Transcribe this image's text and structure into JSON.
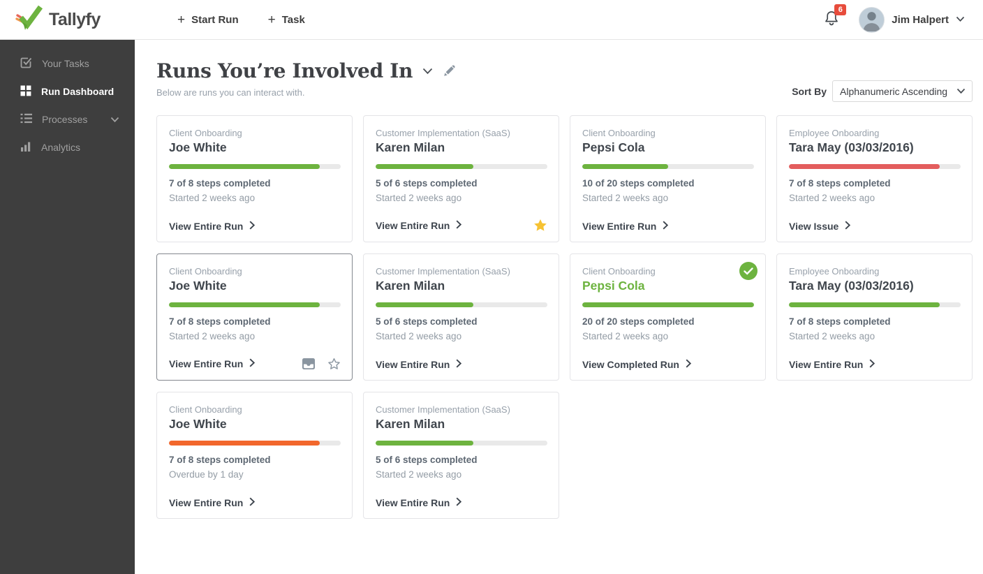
{
  "topbar": {
    "logo_text": "Tallyfy",
    "start_run_label": "Start Run",
    "task_label": "Task",
    "notification_count": "6",
    "user_name": "Jim Halpert"
  },
  "sidebar": {
    "items": [
      {
        "label": "Your Tasks",
        "icon": "tasks-check-icon",
        "active": false
      },
      {
        "label": "Run Dashboard",
        "icon": "dashboard-grid-icon",
        "active": true
      },
      {
        "label": "Processes",
        "icon": "processes-list-icon",
        "active": false,
        "has_chevron": true
      },
      {
        "label": "Analytics",
        "icon": "bar-chart-icon",
        "active": false
      }
    ]
  },
  "header": {
    "title": "Runs You’re Involved In",
    "subtitle": "Below are runs you can interact with.",
    "sort_by_label": "Sort By",
    "sort_value": "Alphanumeric Ascending"
  },
  "colors": {
    "green": "#6db33f",
    "red": "#e35d5d",
    "orange": "#f2672c",
    "track": "#e9e9e9",
    "star_yellow": "#f6c233",
    "badge_red": "#e74c3c",
    "sidebar_bg": "#3e3e3e"
  },
  "cards": [
    {
      "process": "Client Onboarding",
      "name": "Joe White",
      "progress_pct": 88,
      "bar_color": "green",
      "steps": "7 of 8 steps completed",
      "status": "Started 2 weeks ago",
      "action": "View Entire Run",
      "footer_icons": [],
      "selected": false
    },
    {
      "process": "Customer Implementation (SaaS)",
      "name": "Karen Milan",
      "progress_pct": 57,
      "bar_color": "green",
      "steps": "5 of 6 steps completed",
      "status": "Started 2 weeks ago",
      "action": "View Entire Run",
      "footer_icons": [
        "favorite-star-filled-icon"
      ],
      "selected": false
    },
    {
      "process": "Client Onboarding",
      "name": "Pepsi Cola",
      "progress_pct": 50,
      "bar_color": "green",
      "steps": "10 of 20 steps completed",
      "status": "Started 2 weeks ago",
      "action": "View Entire Run",
      "footer_icons": [],
      "selected": false
    },
    {
      "process": "Employee Onboarding",
      "name": "Tara May (03/03/2016)",
      "progress_pct": 88,
      "bar_color": "red",
      "steps": "7 of 8 steps completed",
      "status": "Started 2 weeks ago",
      "action": "View Issue",
      "footer_icons": [],
      "selected": false
    },
    {
      "process": "Client Onboarding",
      "name": "Joe White",
      "progress_pct": 88,
      "bar_color": "green",
      "steps": "7 of 8 steps completed",
      "status": "Started 2 weeks ago",
      "action": "View Entire Run",
      "footer_icons": [
        "archive-icon",
        "favorite-star-outline-icon"
      ],
      "selected": true
    },
    {
      "process": "Customer Implementation (SaaS)",
      "name": "Karen Milan",
      "progress_pct": 57,
      "bar_color": "green",
      "steps": "5 of 6 steps completed",
      "status": "Started 2 weeks ago",
      "action": "View Entire Run",
      "footer_icons": [],
      "selected": false
    },
    {
      "process": "Client Onboarding",
      "name": "Pepsi Cola",
      "name_color": "green",
      "progress_pct": 100,
      "bar_color": "green",
      "steps": "20 of 20 steps completed",
      "status": "Started 2 weeks ago",
      "action": "View Completed Run",
      "footer_icons": [],
      "selected": false,
      "badge": "completed-check"
    },
    {
      "process": "Employee Onboarding",
      "name": "Tara May (03/03/2016)",
      "progress_pct": 88,
      "bar_color": "green",
      "steps": "7 of 8 steps completed",
      "status": "Started 2 weeks ago",
      "action": "View Entire Run",
      "footer_icons": [],
      "selected": false
    },
    {
      "process": "Client Onboarding",
      "name": "Joe White",
      "progress_pct": 88,
      "bar_color": "orange",
      "steps": "7 of 8 steps completed",
      "status": "Overdue by 1 day",
      "action": "View Entire Run",
      "footer_icons": [],
      "selected": false
    },
    {
      "process": "Customer Implementation (SaaS)",
      "name": "Karen Milan",
      "progress_pct": 57,
      "bar_color": "green",
      "steps": "5 of 6 steps completed",
      "status": "Started 2 weeks ago",
      "action": "View Entire Run",
      "footer_icons": [],
      "selected": false
    }
  ]
}
